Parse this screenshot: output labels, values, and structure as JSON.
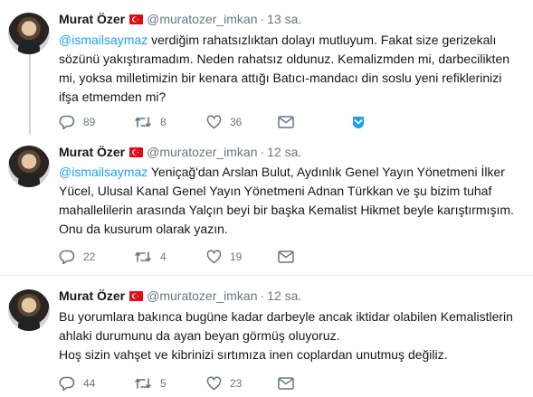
{
  "tweets": [
    {
      "author_name": "Murat Özer",
      "handle": "@muratozer_imkan",
      "dot": "·",
      "time": "13 sa.",
      "mention": "@ismailsaymaz",
      "text": " verdiğim rahatsızlıktan dolayı mutluyum. Fakat size gerizekalı sözünü yakıştıramadım. Neden rahatsız oldunuz. Kemalizmden mi, darbecilikten mi, yoksa milletimizin bir kenara attığı Batıcı-mandacı din soslu yeni refiklerinizi ifşa etmemden mi?",
      "replies": "89",
      "retweets": "8",
      "likes": "36"
    },
    {
      "author_name": "Murat Özer",
      "handle": "@muratozer_imkan",
      "dot": "·",
      "time": "12 sa.",
      "mention": "@ismailsaymaz",
      "text": " Yeniçağ'dan Arslan Bulut, Aydınlık Genel Yayın Yönetmeni İlker Yücel, Ulusal Kanal Genel Yayın Yönetmeni Adnan Türkkan ve şu bizim tuhaf mahallelilerin arasında Yalçın beyi bir başka Kemalist Hikmet beyle karıştırmışım. Onu da kusurum olarak yazın.",
      "replies": "22",
      "retweets": "4",
      "likes": "19"
    },
    {
      "author_name": "Murat Özer",
      "handle": "@muratozer_imkan",
      "dot": "·",
      "time": "12 sa.",
      "mention": "",
      "text": "Bu yorumlara bakınca bugüne kadar darbeyle ancak iktidar olabilen Kemalistlerin ahlaki durumunu da ayan beyan görmüş oluyoruz.\nHoş sizin vahşet ve kibrinizi sırtımıza inen coplardan unutmuş değiliz.",
      "replies": "44",
      "retweets": "5",
      "likes": "23"
    }
  ],
  "colors": {
    "accent": "#1da1f2",
    "muted": "#657786",
    "text": "#14171a",
    "flag": "#e30a17"
  }
}
